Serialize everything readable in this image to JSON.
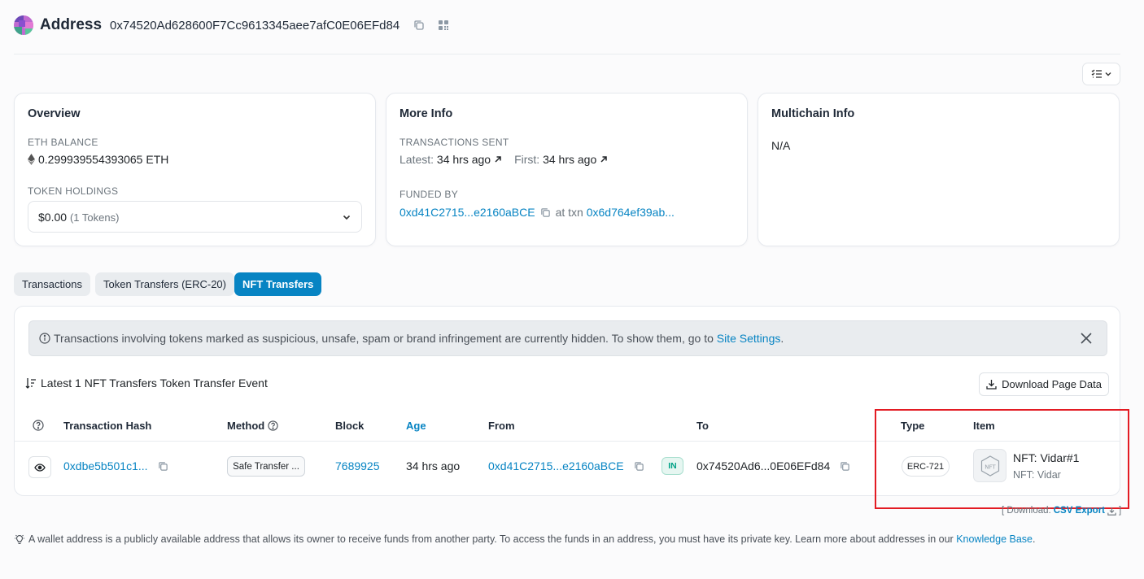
{
  "header": {
    "title": "Address",
    "address": "0x74520Ad628600F7Cc9613345aee7afC0E06EFd84"
  },
  "overview": {
    "title": "Overview",
    "eth_balance_label": "ETH BALANCE",
    "eth_balance_value": "0.299939554393065 ETH",
    "token_holdings_label": "TOKEN HOLDINGS",
    "token_holdings_value": "$0.00",
    "token_holdings_count": "(1 Tokens)"
  },
  "more_info": {
    "title": "More Info",
    "tx_sent_label": "TRANSACTIONS SENT",
    "latest_label": "Latest:",
    "latest_value": "34 hrs ago",
    "first_label": "First:",
    "first_value": "34 hrs ago",
    "funded_by_label": "FUNDED BY",
    "funded_by_address": "0xd41C2715...e2160aBCE",
    "at_txn_label": "at txn",
    "at_txn_hash": "0x6d764ef39ab..."
  },
  "multichain": {
    "title": "Multichain Info",
    "value": "N/A"
  },
  "tabs": [
    {
      "label": "Transactions",
      "active": false
    },
    {
      "label": "Token Transfers (ERC-20)",
      "active": false
    },
    {
      "label": "NFT Transfers",
      "active": true
    }
  ],
  "alert": {
    "text": "Transactions involving tokens marked as suspicious, unsafe, spam or brand infringement are currently hidden. To show them, go to ",
    "link": "Site Settings",
    "suffix": "."
  },
  "summary": "Latest 1 NFT Transfers Token Transfer Event",
  "download_button": "Download Page Data",
  "table": {
    "columns": {
      "hash": "Transaction Hash",
      "method": "Method",
      "block": "Block",
      "age": "Age",
      "from": "From",
      "to": "To",
      "type": "Type",
      "item": "Item"
    },
    "rows": [
      {
        "hash": "0xdbe5b501c1...",
        "method": "Safe Transfer ...",
        "block": "7689925",
        "age": "34 hrs ago",
        "from": "0xd41C2715...e2160aBCE",
        "direction": "IN",
        "to": "0x74520Ad6...0E06EFd84",
        "type": "ERC-721",
        "item_name": "NFT: Vidar#1",
        "item_collection": "NFT: Vidar",
        "item_thumb_text": "NFT"
      }
    ]
  },
  "csv": {
    "prefix": "[ Download:",
    "link": "CSV Export",
    "suffix": "]"
  },
  "footnote": {
    "text": "A wallet address is a publicly available address that allows its owner to receive funds from another party. To access the funds in an address, you must have its private key. Learn more about addresses in our ",
    "link": "Knowledge Base",
    "suffix": "."
  },
  "colors": {
    "accent": "#0784c3",
    "highlight_box": "#e31b23",
    "in_badge": "#00a186"
  }
}
